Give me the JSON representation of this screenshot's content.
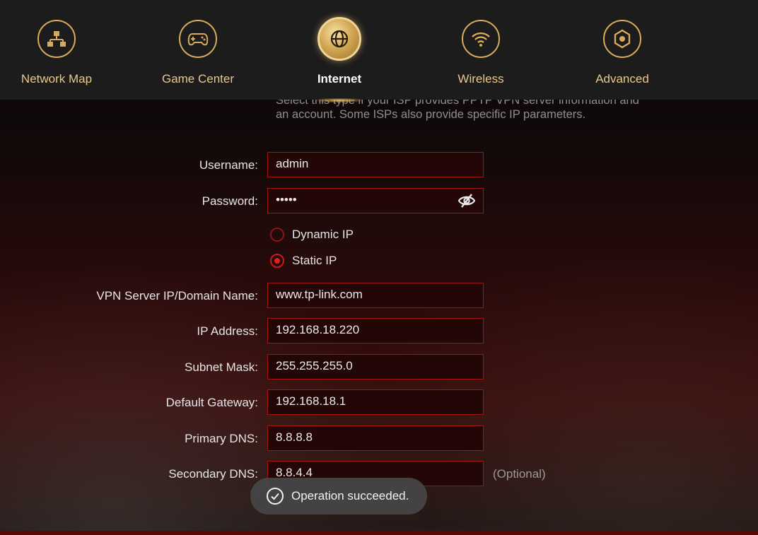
{
  "nav": {
    "items": [
      {
        "label": "Network Map",
        "icon": "network-map-icon"
      },
      {
        "label": "Game Center",
        "icon": "gamepad-icon"
      },
      {
        "label": "Internet",
        "icon": "globe-icon",
        "active": true
      },
      {
        "label": "Wireless",
        "icon": "wifi-icon"
      },
      {
        "label": "Advanced",
        "icon": "gear-icon"
      }
    ],
    "accent_color": "#d6ab5e"
  },
  "form": {
    "description": "Select this type if your ISP provides PPTP VPN server information and an account. Some ISPs also provide specific IP parameters.",
    "username": {
      "label": "Username:",
      "value": "admin"
    },
    "password": {
      "label": "Password:",
      "value": "•••••",
      "toggle_icon": "eye-off-icon"
    },
    "ip_mode": {
      "options": [
        {
          "label": "Dynamic IP",
          "checked": false
        },
        {
          "label": "Static IP",
          "checked": true
        }
      ]
    },
    "vpn_server": {
      "label": "VPN Server IP/Domain Name:",
      "value": "www.tp-link.com"
    },
    "ip_address": {
      "label": "IP Address:",
      "value": "192.168.18.220"
    },
    "subnet_mask": {
      "label": "Subnet Mask:",
      "value": "255.255.255.0"
    },
    "default_gateway": {
      "label": "Default Gateway:",
      "value": "192.168.18.1"
    },
    "primary_dns": {
      "label": "Primary DNS:",
      "value": "8.8.8.8"
    },
    "secondary_dns": {
      "label": "Secondary DNS:",
      "value": "8.8.4.4",
      "hint": "(Optional)"
    },
    "field_border_color": "#a01414"
  },
  "toast": {
    "icon": "check-circle-icon",
    "message": "Operation succeeded."
  }
}
